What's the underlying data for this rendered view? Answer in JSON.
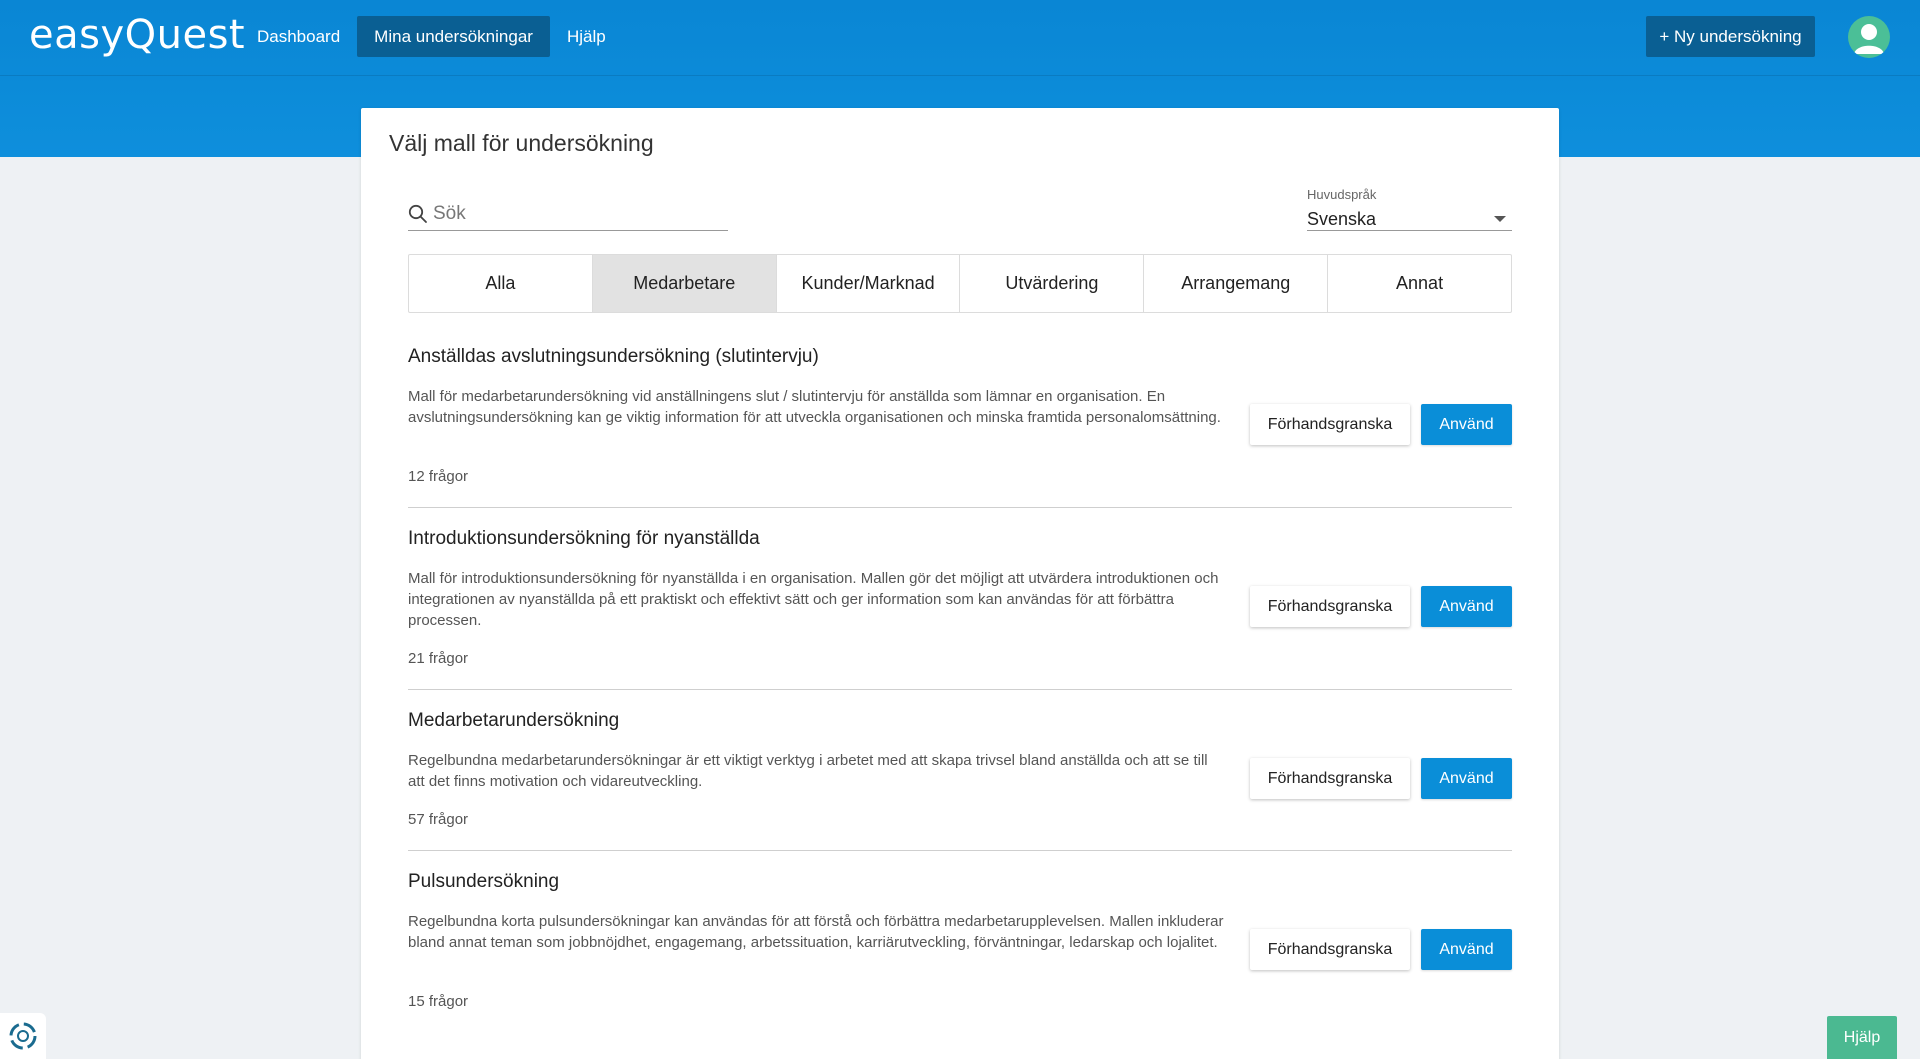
{
  "app": {
    "logo": "easyQuest",
    "brand_color": "#0a86d4",
    "active_nav_color": "#0a5f93",
    "accent_button_color": "#0a8ed8",
    "help_button_color": "#4bb991"
  },
  "nav": {
    "items": [
      {
        "label": "Dashboard",
        "active": false
      },
      {
        "label": "Mina undersökningar",
        "active": true
      },
      {
        "label": "Hjälp",
        "active": false
      }
    ],
    "new_survey_label": "+ Ny undersökning",
    "avatar_icon": "user-avatar-icon"
  },
  "dialog": {
    "title": "Välj mall för undersökning",
    "search": {
      "placeholder": "Sök",
      "value": "",
      "icon": "search-icon"
    },
    "language": {
      "label": "Huvudspråk",
      "value": "Svenska"
    },
    "tabs": [
      {
        "label": "Alla",
        "active": false
      },
      {
        "label": "Medarbetare",
        "active": true
      },
      {
        "label": "Kunder/Marknad",
        "active": false
      },
      {
        "label": "Utvärdering",
        "active": false
      },
      {
        "label": "Arrangemang",
        "active": false
      },
      {
        "label": "Annat",
        "active": false
      }
    ],
    "preview_label": "Förhandsgranska",
    "use_label": "Använd",
    "templates": [
      {
        "title": "Anställdas avslutningsundersökning (slutintervju)",
        "description": "Mall för medarbetarundersökning vid anställningens slut / slutintervju för anställda som lämnar en organisation. En avslutningsundersökning kan ge viktig information för att utveckla organisationen och minska framtida personalomsättning.",
        "count": "12 frågor"
      },
      {
        "title": "Introduktionsundersökning för nyanställda",
        "description": "Mall för introduktionsundersökning för nyanställda i en organisation. Mallen gör det möjligt att utvärdera introduktionen och integrationen av nyanställda på ett praktiskt och effektivt sätt och ger information som kan användas för att förbättra processen.",
        "count": "21 frågor"
      },
      {
        "title": "Medarbetarundersökning",
        "description": "Regelbundna medarbetarundersökningar är ett viktigt verktyg i arbetet med att skapa trivsel bland anställda och att se till att det finns motivation och vidareutveckling.",
        "count": "57 frågor"
      },
      {
        "title": "Pulsundersökning",
        "description": "Regelbundna korta pulsundersökningar kan användas för att förstå och förbättra medarbetarupplevelsen. Mallen inkluderar bland annat teman som jobbnöjdhet, engagemang, arbetssituation, karriärutveckling, förväntningar, ledarskap och lojalitet.",
        "count": "15 frågor"
      }
    ]
  },
  "help_button_label": "Hjälp",
  "corner_widget_icon": "support-widget-icon"
}
